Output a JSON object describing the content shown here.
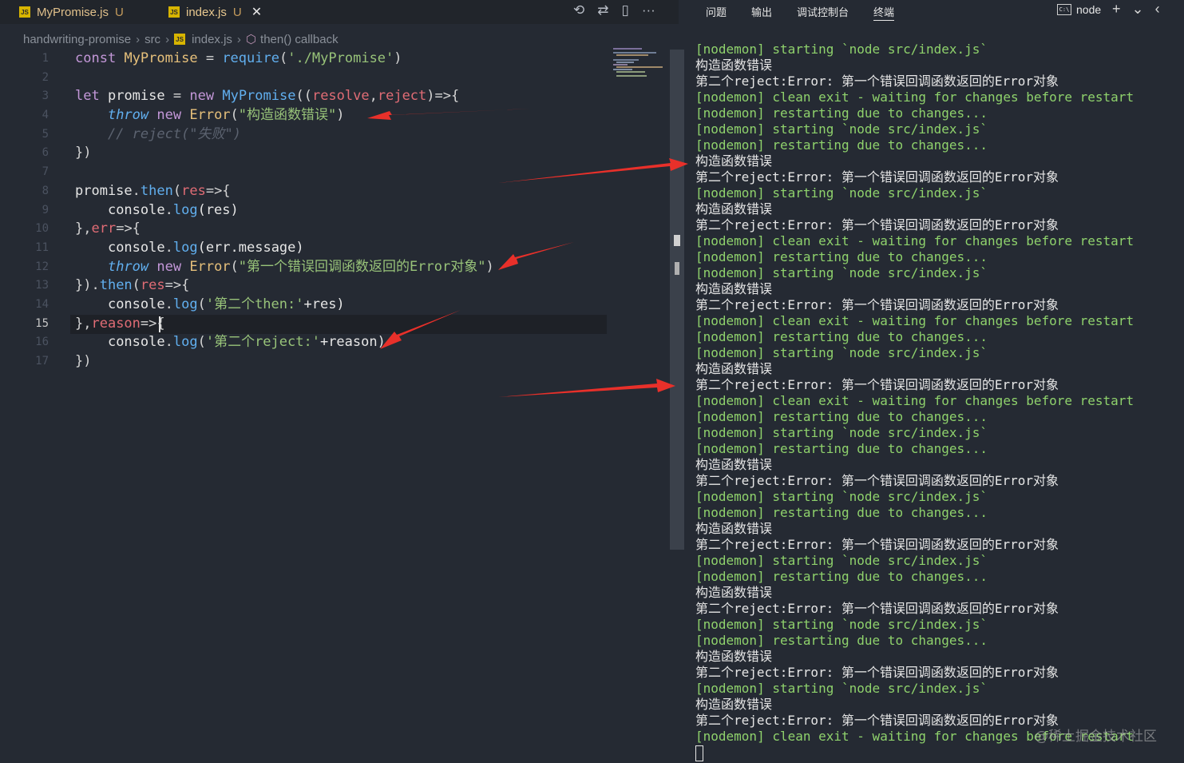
{
  "tabs": [
    {
      "icon": "JS",
      "name": "MyPromise.js",
      "flag": "U",
      "active": false
    },
    {
      "icon": "JS",
      "name": "index.js",
      "flag": "U",
      "active": true,
      "close": "✕"
    }
  ],
  "editor_actions": [
    "⟲",
    "⇄",
    "▯",
    "···"
  ],
  "breadcrumb": {
    "items": [
      "handwriting-promise",
      "src",
      "index.js",
      "then() callback"
    ],
    "separator": "›",
    "file_icon": "JS",
    "symbol_icon": "⬡"
  },
  "line_numbers": [
    "1",
    "2",
    "3",
    "4",
    "5",
    "6",
    "7",
    "8",
    "9",
    "10",
    "11",
    "12",
    "13",
    "14",
    "15",
    "16",
    "17"
  ],
  "current_line": "15",
  "code": {
    "l1": {
      "kw": "const",
      "name": "MyPromise",
      "eq": "=",
      "fn": "require",
      "open": "(",
      "str": "'./MyPromise'",
      "close": ")"
    },
    "l3": {
      "kw": "let",
      "name": "promise",
      "eq": "=",
      "new": "new",
      "cls": "MyPromise",
      "open": "((",
      "p1": "resolve",
      "comma": ",",
      "p2": "reject",
      "arrow": ")=>{"
    },
    "l4": {
      "kw": "throw",
      "new": "new",
      "cls": "Error",
      "open": "(",
      "str": "\"构造函数错误\"",
      "close": ")"
    },
    "l5": {
      "comment": "// reject(\"失败\")"
    },
    "l6": {
      "text": "})"
    },
    "l8": {
      "obj": "promise",
      "dot": ".",
      "fn": "then",
      "open": "(",
      "p": "res",
      "arrow": "=>{"
    },
    "l9": {
      "obj": "console",
      "dot": ".",
      "fn": "log",
      "args": "(res)"
    },
    "l10": {
      "lead": "},",
      "p": "err",
      "arrow": "=>{"
    },
    "l11": {
      "obj": "console",
      "dot": ".",
      "fn": "log",
      "args": "(err.message)"
    },
    "l12": {
      "kw": "throw",
      "new": "new",
      "cls": "Error",
      "open": "(",
      "str": "\"第一个错误回调函数返回的Error对象\"",
      "close": ")"
    },
    "l13": {
      "lead": "}).",
      "fn": "then",
      "open": "(",
      "p": "res",
      "arrow": "=>{"
    },
    "l14": {
      "obj": "console",
      "dot": ".",
      "fn": "log",
      "open": "(",
      "str": "'第二个then:'",
      "rest": "+res)"
    },
    "l15": {
      "lead": "},",
      "p": "reason",
      "arrow": "=>{"
    },
    "l16": {
      "obj": "console",
      "dot": ".",
      "fn": "log",
      "open": "(",
      "str": "'第二个reject:'",
      "rest": "+reason)"
    },
    "l17": {
      "text": "})"
    }
  },
  "panel": {
    "tabs": [
      "问题",
      "输出",
      "调试控制台",
      "终端"
    ],
    "active_tab": "终端",
    "terminal_name": "node",
    "terminal_icon": "C:\\",
    "actions": [
      "+",
      "⌄",
      "‹",
      "›"
    ]
  },
  "terminal_lines": [
    {
      "kind": "nodemon",
      "text": "[nodemon] starting `node src/index.js`"
    },
    {
      "kind": "error",
      "text": "构造函数错误"
    },
    {
      "kind": "error",
      "text": "第二个reject:Error: 第一个错误回调函数返回的Error对象"
    },
    {
      "kind": "nodemon",
      "text": "[nodemon] clean exit - waiting for changes before restart"
    },
    {
      "kind": "nodemon",
      "text": "[nodemon] restarting due to changes..."
    },
    {
      "kind": "nodemon",
      "text": "[nodemon] starting `node src/index.js`"
    },
    {
      "kind": "nodemon",
      "text": "[nodemon] restarting due to changes..."
    },
    {
      "kind": "error",
      "text": "构造函数错误"
    },
    {
      "kind": "error",
      "text": "第二个reject:Error: 第一个错误回调函数返回的Error对象"
    },
    {
      "kind": "nodemon",
      "text": "[nodemon] starting `node src/index.js`"
    },
    {
      "kind": "error",
      "text": "构造函数错误"
    },
    {
      "kind": "error",
      "text": "第二个reject:Error: 第一个错误回调函数返回的Error对象"
    },
    {
      "kind": "nodemon",
      "text": "[nodemon] clean exit - waiting for changes before restart"
    },
    {
      "kind": "nodemon",
      "text": "[nodemon] restarting due to changes..."
    },
    {
      "kind": "nodemon",
      "text": "[nodemon] starting `node src/index.js`"
    },
    {
      "kind": "error",
      "text": "构造函数错误"
    },
    {
      "kind": "error",
      "text": "第二个reject:Error: 第一个错误回调函数返回的Error对象"
    },
    {
      "kind": "nodemon",
      "text": "[nodemon] clean exit - waiting for changes before restart"
    },
    {
      "kind": "nodemon",
      "text": "[nodemon] restarting due to changes..."
    },
    {
      "kind": "nodemon",
      "text": "[nodemon] starting `node src/index.js`"
    },
    {
      "kind": "error",
      "text": "构造函数错误"
    },
    {
      "kind": "error",
      "text": "第二个reject:Error: 第一个错误回调函数返回的Error对象"
    },
    {
      "kind": "nodemon",
      "text": "[nodemon] clean exit - waiting for changes before restart"
    },
    {
      "kind": "nodemon",
      "text": "[nodemon] restarting due to changes..."
    },
    {
      "kind": "nodemon",
      "text": "[nodemon] starting `node src/index.js`"
    },
    {
      "kind": "nodemon",
      "text": "[nodemon] restarting due to changes..."
    },
    {
      "kind": "error",
      "text": "构造函数错误"
    },
    {
      "kind": "error",
      "text": "第二个reject:Error: 第一个错误回调函数返回的Error对象"
    },
    {
      "kind": "nodemon",
      "text": "[nodemon] starting `node src/index.js`"
    },
    {
      "kind": "nodemon",
      "text": "[nodemon] restarting due to changes..."
    },
    {
      "kind": "error",
      "text": "构造函数错误"
    },
    {
      "kind": "error",
      "text": "第二个reject:Error: 第一个错误回调函数返回的Error对象"
    },
    {
      "kind": "nodemon",
      "text": "[nodemon] starting `node src/index.js`"
    },
    {
      "kind": "nodemon",
      "text": "[nodemon] restarting due to changes..."
    },
    {
      "kind": "error",
      "text": "构造函数错误"
    },
    {
      "kind": "error",
      "text": "第二个reject:Error: 第一个错误回调函数返回的Error对象"
    },
    {
      "kind": "nodemon",
      "text": "[nodemon] starting `node src/index.js`"
    },
    {
      "kind": "nodemon",
      "text": "[nodemon] restarting due to changes..."
    },
    {
      "kind": "error",
      "text": "构造函数错误"
    },
    {
      "kind": "error",
      "text": "第二个reject:Error: 第一个错误回调函数返回的Error对象"
    },
    {
      "kind": "nodemon",
      "text": "[nodemon] starting `node src/index.js`"
    },
    {
      "kind": "error",
      "text": "构造函数错误"
    },
    {
      "kind": "error",
      "text": "第二个reject:Error: 第一个错误回调函数返回的Error对象"
    },
    {
      "kind": "nodemon",
      "text": "[nodemon] clean exit - waiting for changes before restart"
    }
  ],
  "watermark": "@稀土掘金技术社区",
  "colors": {
    "editor_bg": "#252a33",
    "annotation_arrow": "#e8302a",
    "terminal_nodemon": "#8fd26c",
    "keyword": "#c397d8",
    "string": "#98c379",
    "param": "#e06c75"
  }
}
